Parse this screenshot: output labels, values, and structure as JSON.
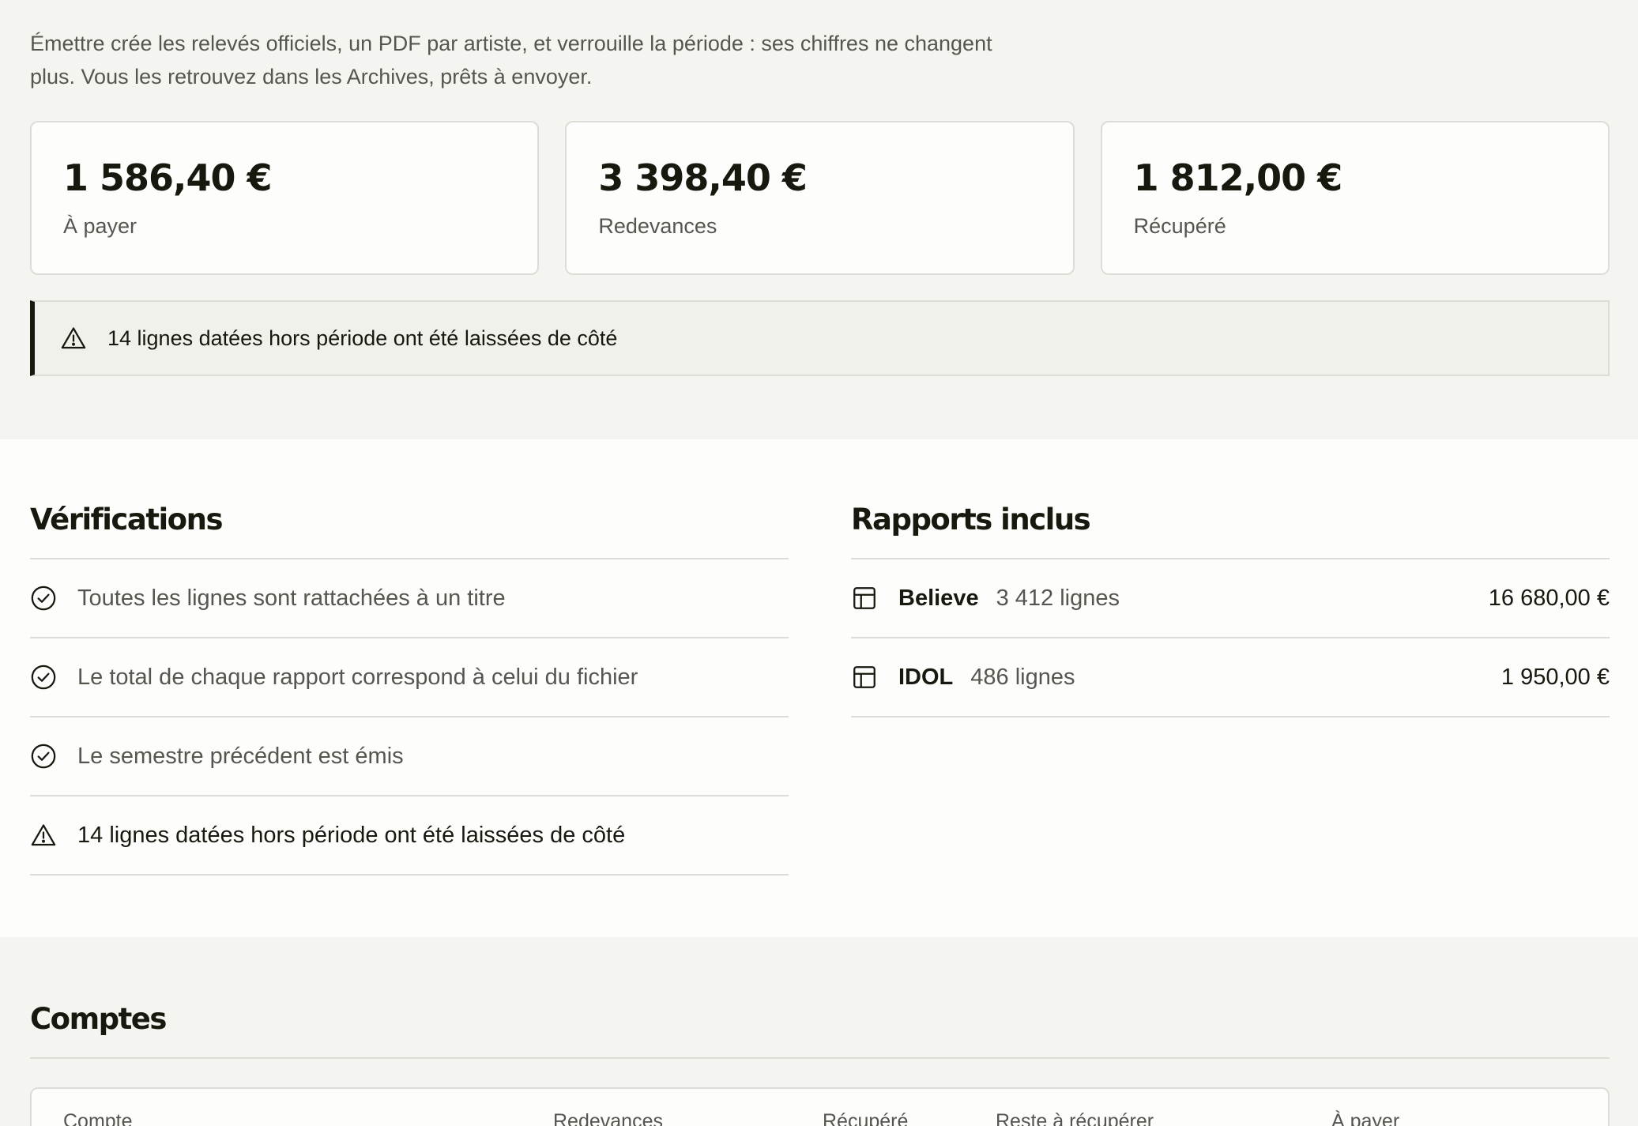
{
  "intro": {
    "line1": "Émettre crée les relevés officiels, un PDF par artiste, et verrouille la période : ses chiffres ne changent",
    "line2": "plus. Vous les retrouvez dans les Archives, prêts à envoyer."
  },
  "summary_cards": [
    {
      "amount": "1 586,40 €",
      "label": "À payer"
    },
    {
      "amount": "3 398,40 €",
      "label": "Redevances"
    },
    {
      "amount": "1 812,00 €",
      "label": "Récupéré"
    }
  ],
  "alert": {
    "icon": "warning-triangle-icon",
    "text": "14 lignes datées hors période ont été laissées de côté"
  },
  "verifications": {
    "title": "Vérifications",
    "items": [
      {
        "icon": "check-circle-icon",
        "text": "Toutes les lignes sont rattachées à un titre",
        "status": "ok"
      },
      {
        "icon": "check-circle-icon",
        "text": "Le total de chaque rapport correspond à celui du fichier",
        "status": "ok"
      },
      {
        "icon": "check-circle-icon",
        "text": "Le semestre précédent est émis",
        "status": "ok"
      },
      {
        "icon": "warning-triangle-icon",
        "text": "14 lignes datées hors période ont été laissées de côté",
        "status": "warning"
      }
    ]
  },
  "reports": {
    "title": "Rapports inclus",
    "items": [
      {
        "icon": "table-icon",
        "name": "Believe",
        "lines": "3 412 lignes",
        "amount": "16 680,00 €"
      },
      {
        "icon": "table-icon",
        "name": "IDOL",
        "lines": "486 lignes",
        "amount": "1 950,00 €"
      }
    ]
  },
  "accounts": {
    "title": "Comptes",
    "columns": [
      "Compte",
      "Redevances",
      "Récupéré",
      "Reste à récupérer",
      "À payer"
    ]
  },
  "colors": {
    "background": "#f4f4f0",
    "surface": "#fdfdfb",
    "border": "#dcddd6",
    "text": "#17190f",
    "muted": "#55574f"
  }
}
